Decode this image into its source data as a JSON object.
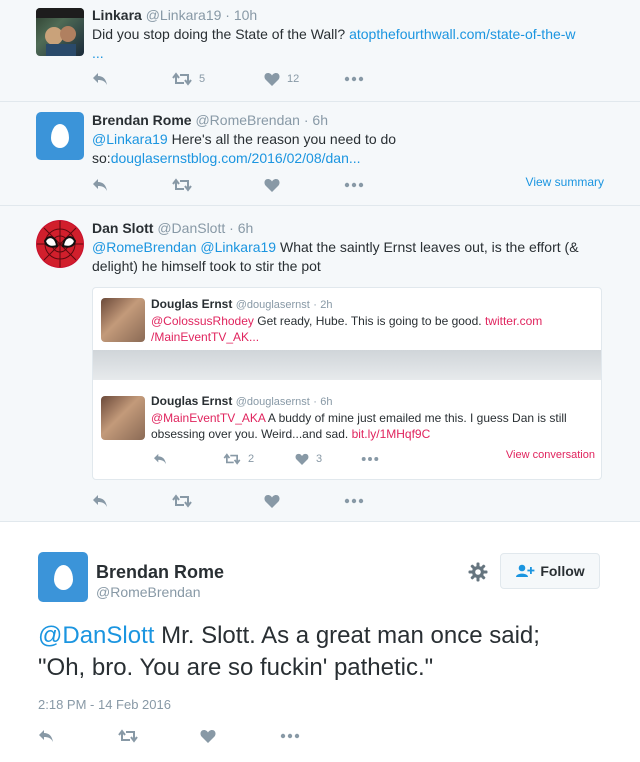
{
  "tweets": [
    {
      "name": "Linkara",
      "handle": "@Linkara19",
      "time": "10h",
      "text": "Did you stop doing the State of the Wall? ",
      "link": "atopthefourthwall.com/state-of-the-w",
      "ellipsis": "...",
      "retweets": "5",
      "likes": "12"
    },
    {
      "name": "Brendan Rome",
      "handle": "@RomeBrendan",
      "time": "6h",
      "mention": "@Linkara19",
      "text": " Here's all the reason you need to do so:",
      "link": "douglasernstblog.com/2016/02/08/dan...",
      "summary": "View summary"
    },
    {
      "name": "Dan Slott",
      "handle": "@DanSlott",
      "time": "6h",
      "mention1": "@RomeBrendan",
      "mention2": "@Linkara19",
      "text": " What the saintly Ernst leaves out, is the effort (& delight) he himself took to stir the pot"
    }
  ],
  "quoted": [
    {
      "name": "Douglas Ernst",
      "handle": "@douglasernst",
      "time": "2h",
      "mention": "@ColossusRhodey",
      "text": " Get ready, Hube. This is going to be good. ",
      "link1": "twitter.com",
      "link2": "/MainEventTV_AK..."
    },
    {
      "name": "Douglas Ernst",
      "handle": "@douglasernst",
      "time": "6h",
      "mention": "@MainEventTV_AKA",
      "text": " A buddy of mine just emailed me this. I guess Dan is still obsessing over you. Weird...and sad. ",
      "link": "bit.ly/1MHqf9C",
      "retweets": "2",
      "likes": "3",
      "conversation": "View conversation"
    }
  ],
  "expanded": {
    "name": "Brendan Rome",
    "handle": "@RomeBrendan",
    "follow_label": "Follow",
    "mention": "@DanSlott",
    "text1": " Mr. Slott. As a great man once said;",
    "text2": "\"Oh, bro. You are so fuckin' pathetic.\"",
    "timestamp": "2:18 PM - 14 Feb 2016"
  },
  "dot": "·",
  "colors": {
    "link": "#1b95e0",
    "quote_link": "#e0245e",
    "muted": "#8899a6",
    "egg": "#3b94d9"
  }
}
